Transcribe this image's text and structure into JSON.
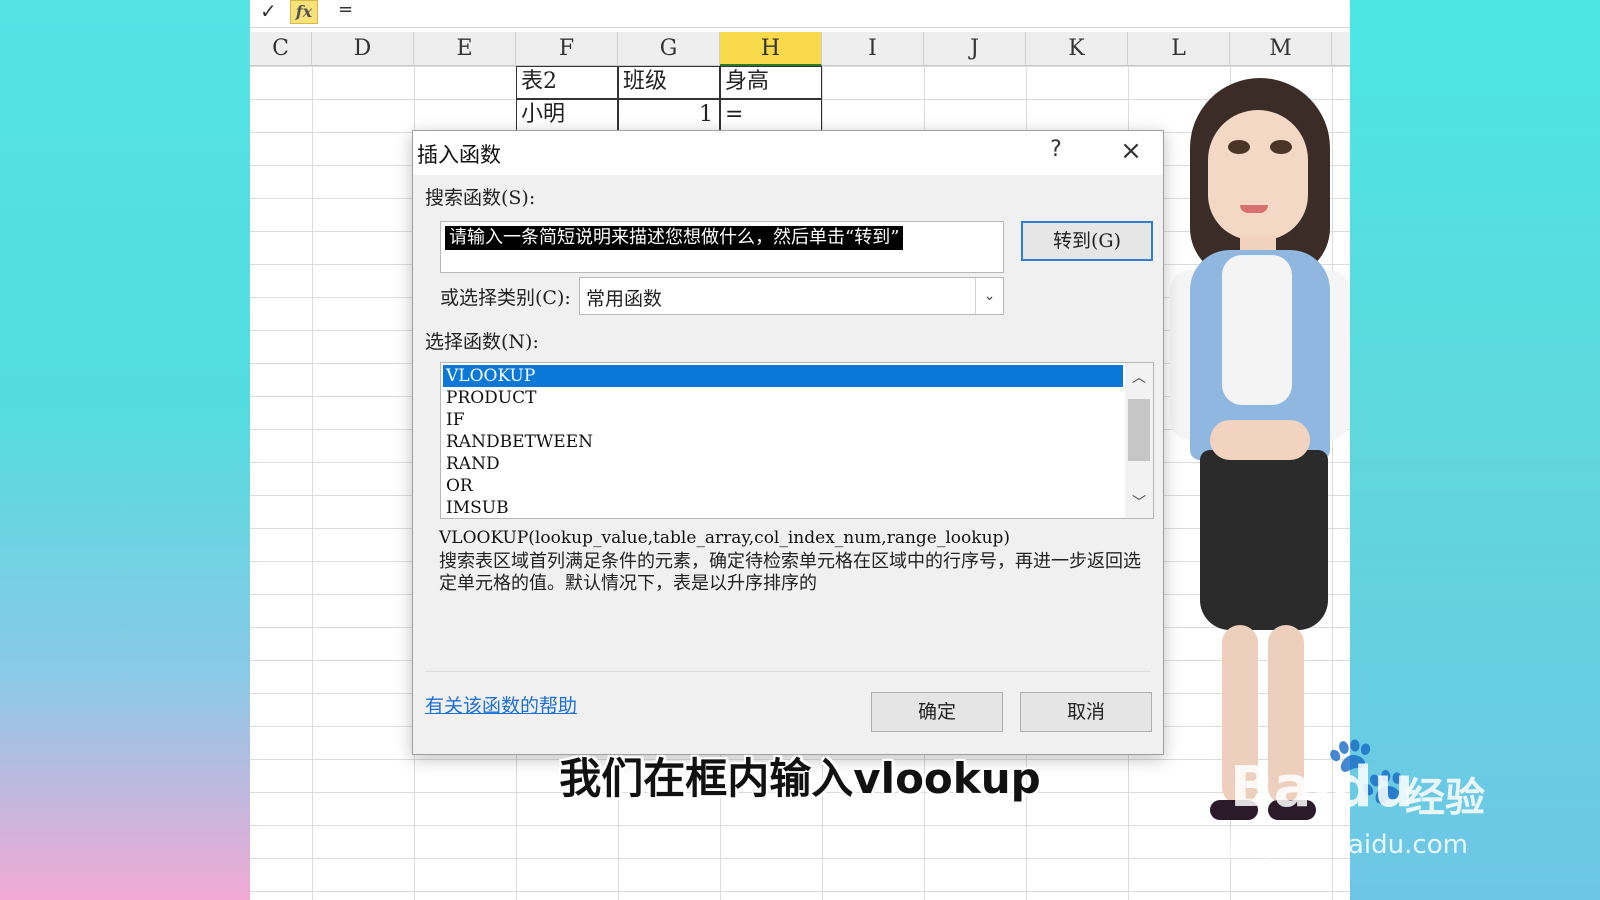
{
  "formula_bar": {
    "check_icon": "checkmark-icon",
    "fx_label": "fx",
    "value": "="
  },
  "columns": [
    "C",
    "D",
    "E",
    "F",
    "G",
    "H",
    "I",
    "J",
    "K",
    "L",
    "M"
  ],
  "active_column": "H",
  "cells": {
    "F1": "表2",
    "G1": "班级",
    "H1": "身高",
    "F2": "小明",
    "G2": "1",
    "H2": "="
  },
  "dialog": {
    "title": "插入函数",
    "help_glyph": "?",
    "close_glyph": "×",
    "search_label": "搜索函数(S):",
    "search_value": "请输入一条简短说明来描述您想做什么，然后单击“转到”",
    "goto_label": "转到(G)",
    "category_label": "或选择类别(C):",
    "category_value": "常用函数",
    "select_label": "选择函数(N):",
    "functions": [
      "VLOOKUP",
      "PRODUCT",
      "IF",
      "RANDBETWEEN",
      "RAND",
      "OR",
      "IMSUB"
    ],
    "selected_function": "VLOOKUP",
    "syntax": "VLOOKUP(lookup_value,table_array,col_index_num,range_lookup)",
    "description": "搜索表区域首列满足条件的元素，确定待检索单元格在区域中的行序号，再进一步返回选定单元格的值。默认情况下，表是以升序排序的",
    "help_link": "有关该函数的帮助",
    "ok_label": "确定",
    "cancel_label": "取消"
  },
  "subtitle": "我们在框内输入vlookup",
  "watermark": {
    "brand": "Baidu",
    "product": "经验",
    "url": "jingyan.baidu.com"
  }
}
